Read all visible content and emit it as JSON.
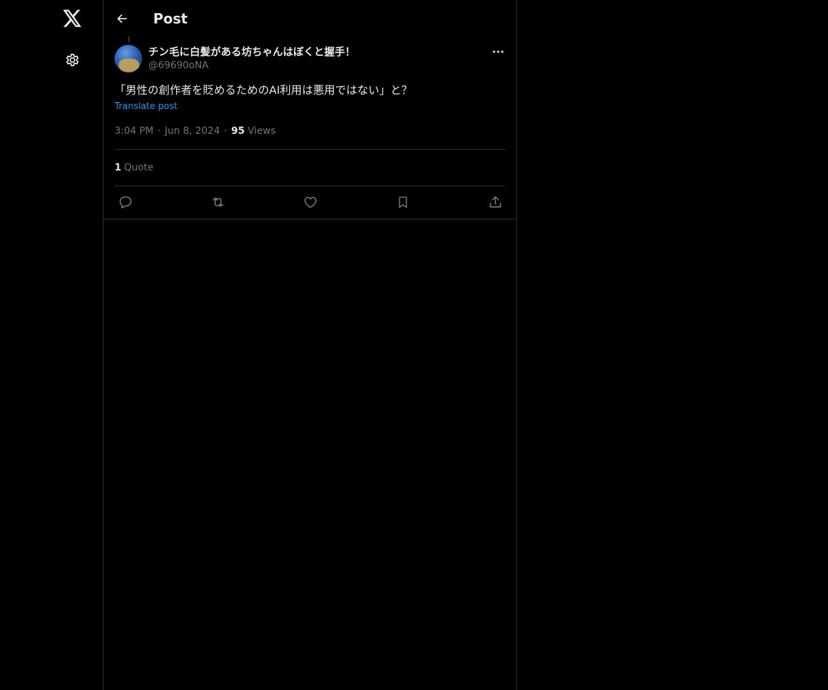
{
  "header": {
    "title": "Post"
  },
  "nav": {
    "logo_icon": "x-logo-icon",
    "settings_icon": "gear-icon"
  },
  "tweet": {
    "display_name": "チン毛に白髪がある坊ちゃんはぼくと握手！",
    "handle": "@69690oNA",
    "text": "「男性の創作者を貶めるためのAI利用は悪用ではない」と？",
    "translate_label": "Translate post",
    "time": "3:04 PM",
    "separator": "·",
    "date": "Jun 8, 2024",
    "views_count": "95",
    "views_label": "Views",
    "quote_count": "1",
    "quote_label": "Quote"
  },
  "actions": {
    "reply_icon": "reply-icon",
    "repost_icon": "repost-icon",
    "like_icon": "heart-icon",
    "bookmark_icon": "bookmark-icon",
    "share_icon": "share-icon"
  },
  "colors": {
    "background": "#000000",
    "text_primary": "#e7e9ea",
    "text_secondary": "#71767b",
    "link": "#1d9bf0",
    "border": "#2f3336"
  }
}
